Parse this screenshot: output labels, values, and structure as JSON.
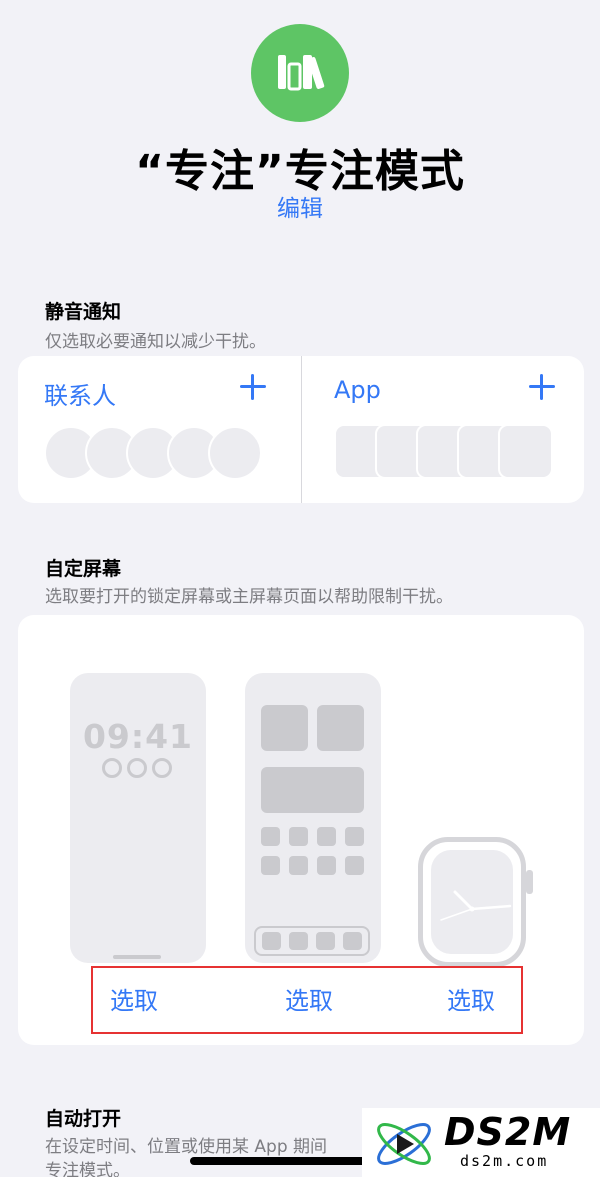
{
  "header": {
    "title": "“专注”专注模式",
    "edit_label": "编辑",
    "icon": "books-icon",
    "accent_color": "#5ec565"
  },
  "silence_notifications": {
    "title": "静音通知",
    "subtitle": "仅选取必要通知以减少干扰。",
    "people_label": "联系人",
    "apps_label": "App"
  },
  "custom_screens": {
    "title": "自定屏幕",
    "subtitle": "选取要打开的锁定屏幕或主屏幕页面以帮助限制干扰。",
    "lock_time": "09:41",
    "choose_lock": "选取",
    "choose_home": "选取",
    "choose_watch": "选取"
  },
  "auto_on": {
    "title": "自动打开",
    "subtitle_line1": "在设定时间、位置或使用某 App 期间",
    "subtitle_line2": "专注模式。"
  },
  "watermark": {
    "brand": "DS2M",
    "url": "ds2m.com"
  },
  "colors": {
    "link": "#3478f6",
    "highlight_border": "#e63232"
  }
}
